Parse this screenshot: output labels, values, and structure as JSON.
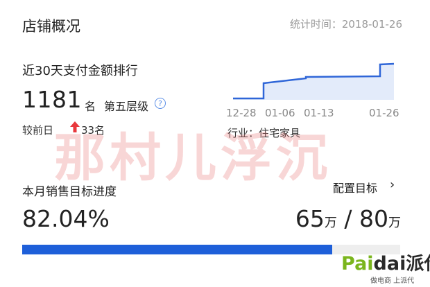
{
  "header": {
    "title": "店铺概况",
    "stat_time": "统计时间：2018-01-26"
  },
  "payment_rank": {
    "title": "近30天支付金额排行",
    "rank": "1181",
    "rank_unit": "名",
    "level": "第五层级",
    "compare_label": "较前日",
    "compare_value": "33名",
    "compare_direction": "up",
    "industry": "行业：住宅家具",
    "trend": {
      "x_ticks": [
        "12-28",
        "01-06",
        "01-13",
        "01-26"
      ],
      "line_color": "#2f66d8",
      "fill_color": "#e3ebfa"
    }
  },
  "watermark": "那村儿浮沉",
  "sales_target": {
    "title": "本月销售目标进度",
    "config_label": "配置目标",
    "percent_text": "82.04%",
    "current": "65",
    "current_unit": "万",
    "separator": "/",
    "target": "80",
    "target_unit": "万",
    "progress": 0.8204,
    "bar_color": "#1e5fd9"
  },
  "logo": {
    "part1": "Pai",
    "part2": "dai",
    "cn": "派代",
    "slogan": "做电商 上派代"
  }
}
